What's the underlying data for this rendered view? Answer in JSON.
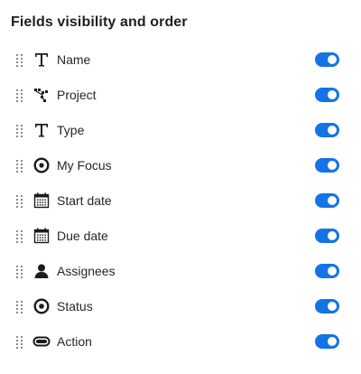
{
  "panel": {
    "title": "Fields visibility and order",
    "accent_color": "#1473e6"
  },
  "fields": [
    {
      "label": "Name",
      "icon": "text-type-icon",
      "visible": true
    },
    {
      "label": "Project",
      "icon": "project-hierarchy-icon",
      "visible": true
    },
    {
      "label": "Type",
      "icon": "text-type-icon",
      "visible": true
    },
    {
      "label": "My Focus",
      "icon": "target-icon",
      "visible": true
    },
    {
      "label": "Start date",
      "icon": "calendar-icon",
      "visible": true
    },
    {
      "label": "Due date",
      "icon": "calendar-icon",
      "visible": true
    },
    {
      "label": "Assignees",
      "icon": "person-icon",
      "visible": true
    },
    {
      "label": "Status",
      "icon": "status-circle-icon",
      "visible": true
    },
    {
      "label": "Action",
      "icon": "action-pill-icon",
      "visible": true
    }
  ]
}
